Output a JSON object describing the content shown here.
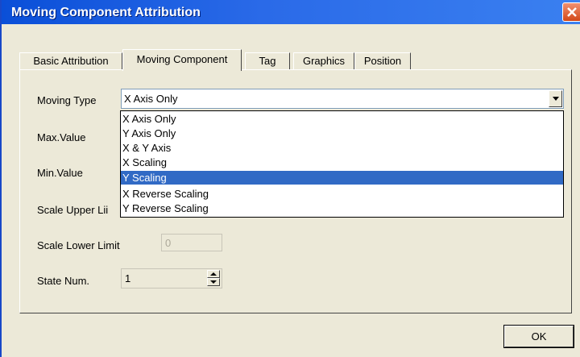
{
  "window": {
    "title": "Moving Component Attribution",
    "close_icon": "close-icon"
  },
  "tabs": [
    {
      "label": "Basic Attribution"
    },
    {
      "label": "Moving Component",
      "active": true
    },
    {
      "label": "Tag"
    },
    {
      "label": "Graphics"
    },
    {
      "label": "Position"
    }
  ],
  "form": {
    "moving_type_label": "Moving Type",
    "moving_type_value": "X Axis Only",
    "max_value_label": "Max.Value",
    "min_value_label": "Min.Value",
    "scale_upper_label": "Scale Upper Lii",
    "scale_lower_label": "Scale Lower Limit",
    "scale_lower_value": "0",
    "state_num_label": "State Num.",
    "state_num_value": "1"
  },
  "dropdown": {
    "options": [
      "X Axis Only",
      "Y Axis Only",
      "X & Y Axis",
      "X Scaling",
      "Y Scaling",
      "X Reverse Scaling",
      "Y Reverse Scaling"
    ],
    "highlighted": "Y Scaling"
  },
  "buttons": {
    "ok_label": "OK"
  },
  "colors": {
    "title_bar": "#2a6ae8",
    "selection": "#316ac5",
    "close": "#d24818"
  }
}
